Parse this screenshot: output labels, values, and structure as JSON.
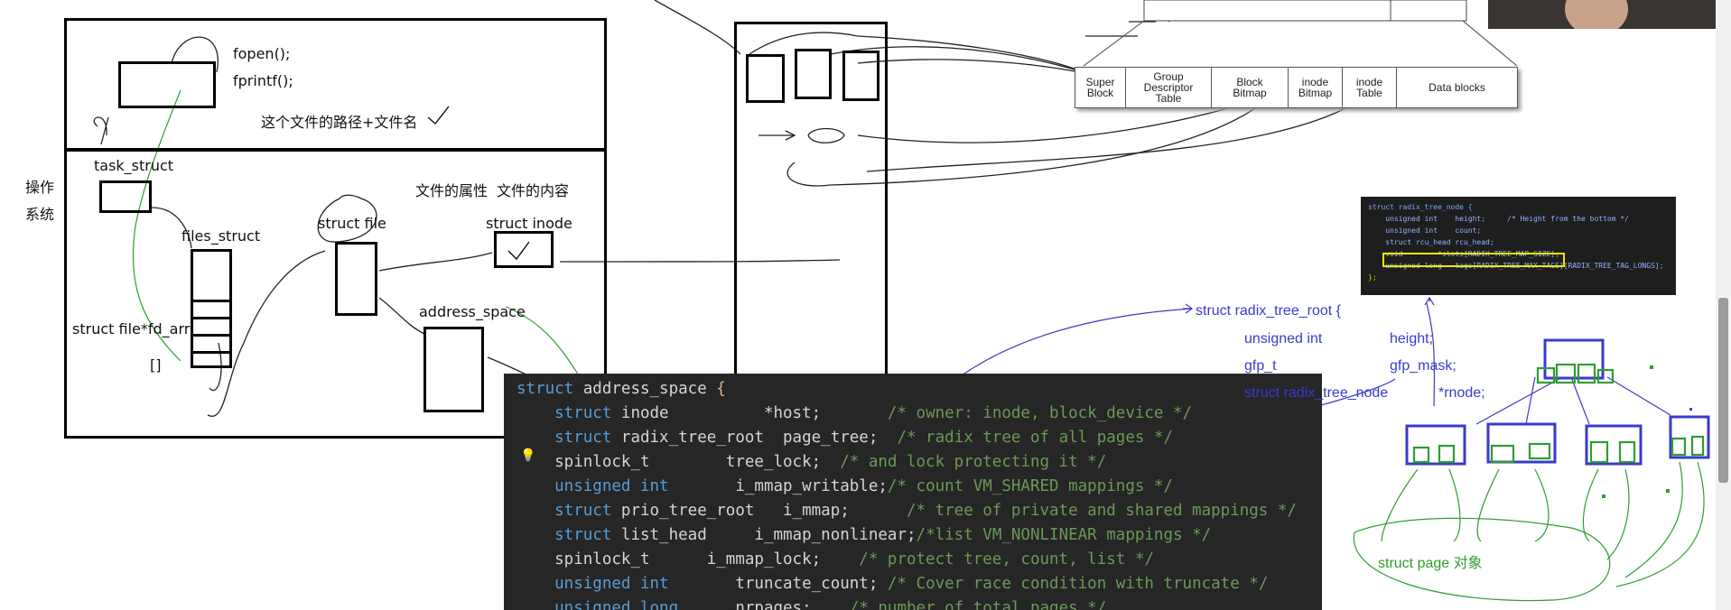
{
  "left_panel": {
    "fopen": "fopen();",
    "fprintf": "fprintf();",
    "path_label": "这个文件的路径+文件名",
    "os_label": "操作\n系统",
    "task_struct": "task_struct",
    "files_struct": "files_struct",
    "fd_arr": "struct file*fd_arr",
    "brackets": "[]",
    "struct_file": "struct file",
    "file_attr": "文件的属性",
    "file_content": "文件的内容",
    "struct_inode": "struct inode",
    "address_space": "address_space"
  },
  "ext2_layout": {
    "cells": [
      "Super\nBlock",
      "Group\nDescriptor\nTable",
      "Block\nBitmap",
      "inode\nBitmap",
      "inode\nTable",
      "Data blocks"
    ]
  },
  "code": {
    "lines": [
      {
        "parts": [
          {
            "t": "struct ",
            "c": "kw"
          },
          {
            "t": "address_space ",
            "c": ""
          },
          {
            "t": "{",
            "c": "br"
          }
        ]
      },
      {
        "parts": [
          {
            "t": "    struct ",
            "c": "kw"
          },
          {
            "t": "inode          *host;       ",
            "c": ""
          },
          {
            "t": "/* owner: inode, block_device */",
            "c": "cm"
          }
        ]
      },
      {
        "parts": [
          {
            "t": "    struct ",
            "c": "kw"
          },
          {
            "t": "radix_tree_root  page_tree;  ",
            "c": ""
          },
          {
            "t": "/* radix tree of all pages */",
            "c": "cm"
          }
        ]
      },
      {
        "parts": [
          {
            "t": "    spinlock_t        tree_lock;  ",
            "c": ""
          },
          {
            "t": "/* and lock protecting it */",
            "c": "cm"
          }
        ]
      },
      {
        "parts": [
          {
            "t": "    unsigned int ",
            "c": "kw"
          },
          {
            "t": "      i_mmap_writable;",
            "c": ""
          },
          {
            "t": "/* count VM_SHARED mappings */",
            "c": "cm"
          }
        ]
      },
      {
        "parts": [
          {
            "t": "    struct ",
            "c": "kw"
          },
          {
            "t": "prio_tree_root   i_mmap;      ",
            "c": ""
          },
          {
            "t": "/* tree of private and shared mappings */",
            "c": "cm"
          }
        ]
      },
      {
        "parts": [
          {
            "t": "    struct ",
            "c": "kw"
          },
          {
            "t": "list_head     i_mmap_nonlinear;",
            "c": ""
          },
          {
            "t": "/*list VM_NONLINEAR mappings */",
            "c": "cm"
          }
        ]
      },
      {
        "parts": [
          {
            "t": "    spinlock_t      i_mmap_lock;    ",
            "c": ""
          },
          {
            "t": "/* protect tree, count, list */",
            "c": "cm"
          }
        ]
      },
      {
        "parts": [
          {
            "t": "    unsigned int ",
            "c": "kw"
          },
          {
            "t": "      truncate_count; ",
            "c": ""
          },
          {
            "t": "/* Cover race condition with truncate */",
            "c": "cm"
          }
        ]
      },
      {
        "parts": [
          {
            "t": "    unsigned long ",
            "c": "kw"
          },
          {
            "t": "     nrpages;    ",
            "c": ""
          },
          {
            "t": "/* number of total pages */",
            "c": "cm"
          }
        ]
      }
    ]
  },
  "mini_code": {
    "lines": [
      "struct radix_tree_node {",
      "    unsigned int    height;     /* Height from the bottom */",
      "    unsigned int    count;",
      "    struct rcu_head rcu_head;",
      "    void        *slots[RADIX_TREE_MAP_SIZE];",
      "    unsigned long   tags[RADIX_TREE_MAX_TAGS][RADIX_TREE_TAG_LONGS];",
      "};"
    ]
  },
  "radix_root": {
    "line1": "struct radix_tree_root {",
    "line2a": "unsigned int",
    "line2b": "height;",
    "line3a": "gfp_t",
    "line3b": "gfp_mask;",
    "line4a": "struct radix_tree_node",
    "line4b": "*rnode;"
  },
  "page_label": "struct page 对象",
  "colors": {
    "ink": "#000000",
    "blue": "#3a3acc",
    "green": "#2e9e2e",
    "yellow": "#e0d400",
    "code_bg": "#262626"
  }
}
